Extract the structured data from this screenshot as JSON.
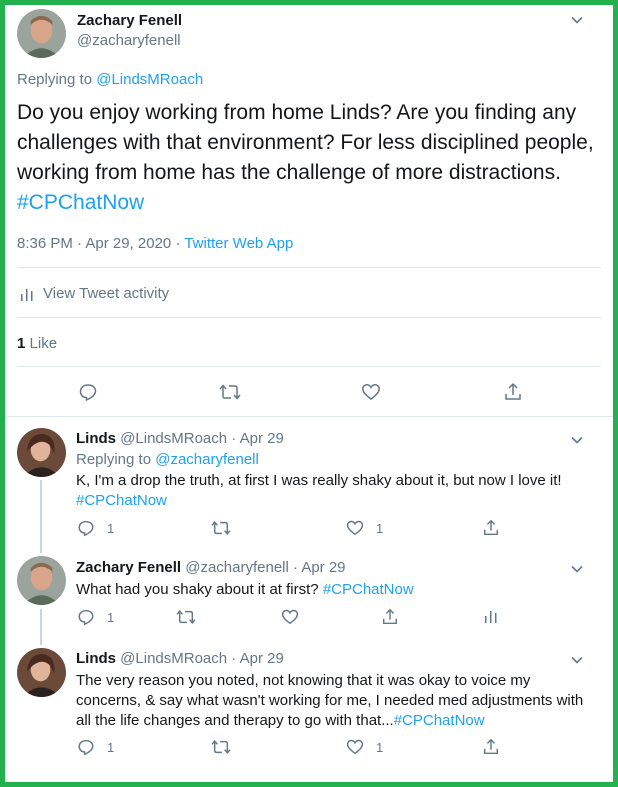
{
  "main_tweet": {
    "author_name": "Zachary Fenell",
    "author_handle": "@zacharyfenell",
    "replying_label": "Replying to",
    "replying_to": "@LindsMRoach",
    "text": "Do you enjoy working from home Linds? Are you finding any challenges with that environment? For less disciplined people, working from home has the challenge of more distractions.",
    "hashtag": "#CPChatNow",
    "timestamp": "8:36 PM · Apr 29, 2020",
    "separator": "·",
    "source": "Twitter Web App",
    "activity_label": "View Tweet activity",
    "like_count": "1",
    "like_label": "Like"
  },
  "replies": [
    {
      "author_name": "Linds",
      "author_handle": "@LindsMRoach",
      "date": "· Apr 29",
      "replying_label": "Replying to",
      "replying_to": "@zacharyfenell",
      "text": "K, I'm a drop the truth, at first I was really shaky about it, but now I love it!",
      "hashtag": "#CPChatNow",
      "reply_count": "1",
      "like_count": "1"
    },
    {
      "author_name": "Zachary Fenell",
      "author_handle": "@zacharyfenell",
      "date": "· Apr 29",
      "text": "What had you shaky about it at first?",
      "hashtag": "#CPChatNow",
      "reply_count": "1"
    },
    {
      "author_name": "Linds",
      "author_handle": "@LindsMRoach",
      "date": "· Apr 29",
      "text": "The very reason you noted, not knowing that it was okay to voice my concerns, & say what wasn't working for me, I needed med adjustments with all the life changes and therapy to go with that...",
      "hashtag": "#CPChatNow",
      "reply_count": "1",
      "like_count": "1"
    }
  ],
  "colors": {
    "frame_border": "#22b14c",
    "link": "#1da1f2",
    "secondary_text": "#657786",
    "divider": "#e1e8ed"
  },
  "icons": [
    "chevron-down-icon",
    "bar-chart-icon",
    "reply-icon",
    "retweet-icon",
    "like-icon",
    "share-icon"
  ]
}
